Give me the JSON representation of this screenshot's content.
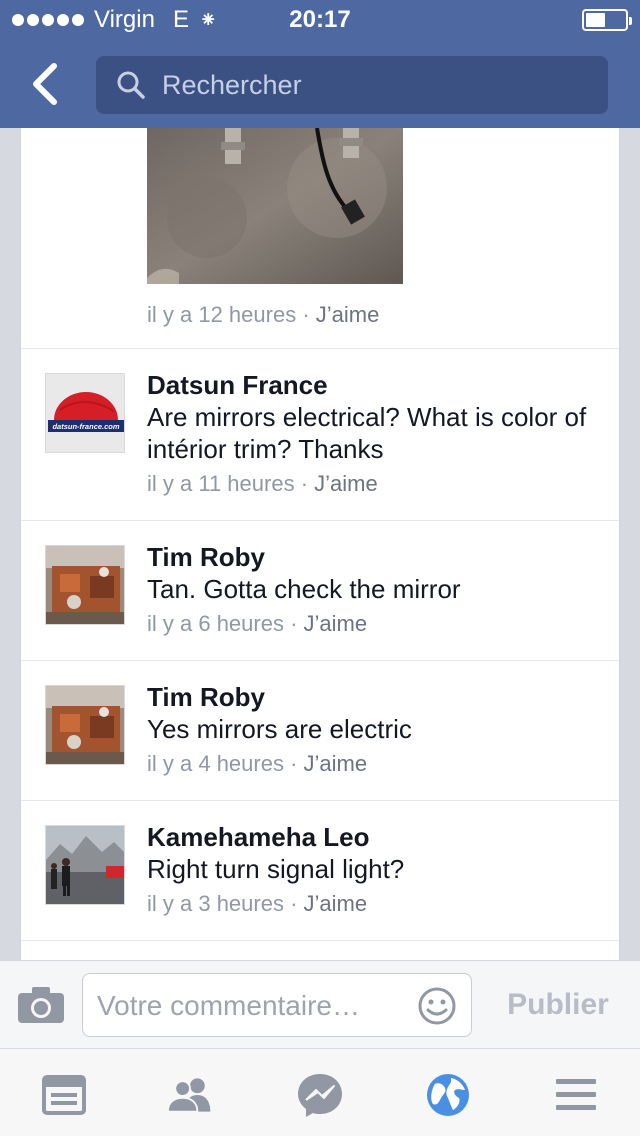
{
  "status_bar": {
    "carrier": "Virgin",
    "network": "E",
    "time": "20:17",
    "battery_level": 0.5
  },
  "nav": {
    "search_placeholder": "Rechercher"
  },
  "first_comment": {
    "time": "il y a 12 heures",
    "separator": " · ",
    "like_label": "J’aime"
  },
  "comments": [
    {
      "name": "Datsun France",
      "text": "Are mirrors electrical? What is color of intérior trim? Thanks",
      "time": "il y a 11 heures",
      "separator": " · ",
      "like_label": "J’aime",
      "avatar_icon": "datsun-france-logo",
      "logo_text": "datsun-france.com"
    },
    {
      "name": "Tim Roby",
      "text": "Tan. Gotta check the mirror",
      "time": "il y a 6 heures",
      "separator": " · ",
      "like_label": "J’aime",
      "avatar_icon": "engine-photo"
    },
    {
      "name": "Tim Roby",
      "text": "Yes mirrors are electric",
      "time": "il y a 4 heures",
      "separator": " · ",
      "like_label": "J’aime",
      "avatar_icon": "engine-photo"
    },
    {
      "name": "Kamehameha Leo",
      "text": "Right turn signal light?",
      "time": "il y a 3 heures",
      "separator": " · ",
      "like_label": "J’aime",
      "avatar_icon": "people-photo"
    }
  ],
  "composer": {
    "placeholder": "Votre commentaire…",
    "publish_label": "Publier"
  },
  "tabbar": {
    "items": [
      "news-feed-icon",
      "friends-icon",
      "messenger-icon",
      "notifications-globe-icon",
      "menu-icon"
    ],
    "active": "notifications-globe-icon"
  },
  "colors": {
    "brand": "#4e69a2",
    "search_bg": "#3b5184",
    "active_tab": "#4a90e2"
  }
}
